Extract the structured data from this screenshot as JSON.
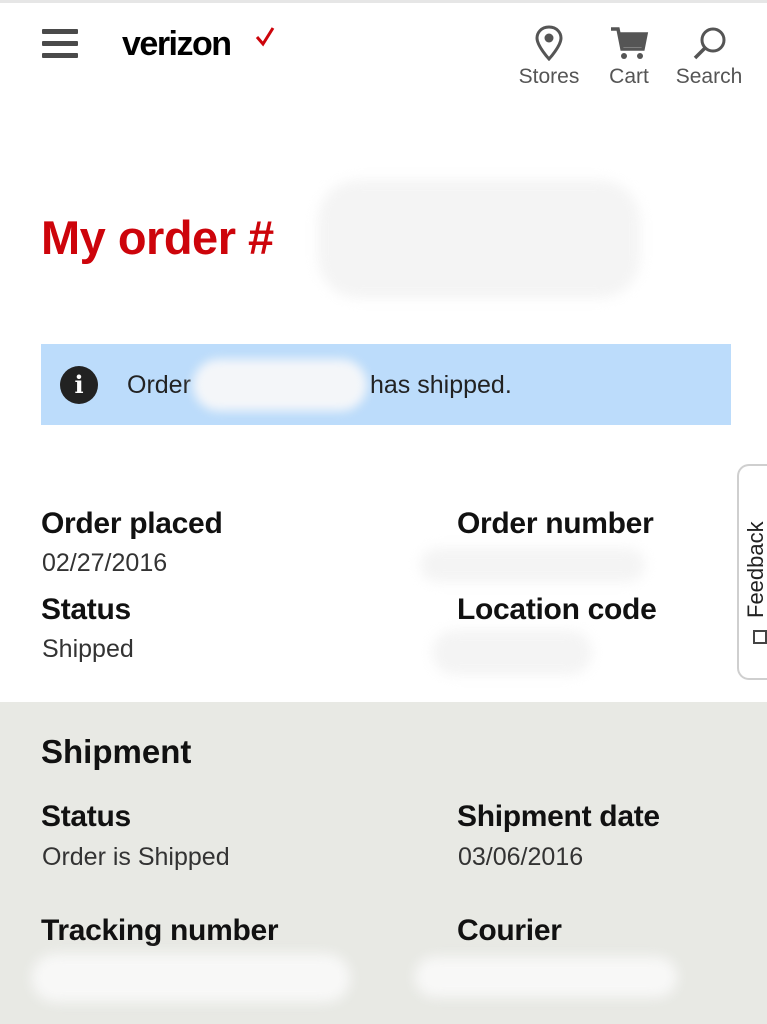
{
  "header": {
    "logo": "verizon",
    "nav": [
      {
        "label": "Stores",
        "icon": "map-pin-icon"
      },
      {
        "label": "Cart",
        "icon": "cart-icon"
      },
      {
        "label": "Search",
        "icon": "search-icon"
      }
    ]
  },
  "page": {
    "title": "My order #"
  },
  "banner": {
    "prefix": "Order",
    "suffix": "has shipped.",
    "icon": "info-icon",
    "color": "#bcdcfb"
  },
  "order": {
    "placed_label": "Order placed",
    "placed_value": "02/27/2016",
    "number_label": "Order number",
    "status_label": "Status",
    "status_value": "Shipped",
    "location_label": "Location code"
  },
  "feedback": {
    "label": "Feedback"
  },
  "shipment": {
    "title": "Shipment",
    "status_label": "Status",
    "status_value": "Order is Shipped",
    "date_label": "Shipment date",
    "date_value": "03/06/2016",
    "tracking_label": "Tracking number",
    "courier_label": "Courier"
  },
  "colors": {
    "brand_red": "#cd040b",
    "shipment_bg": "#e8e9e4"
  }
}
